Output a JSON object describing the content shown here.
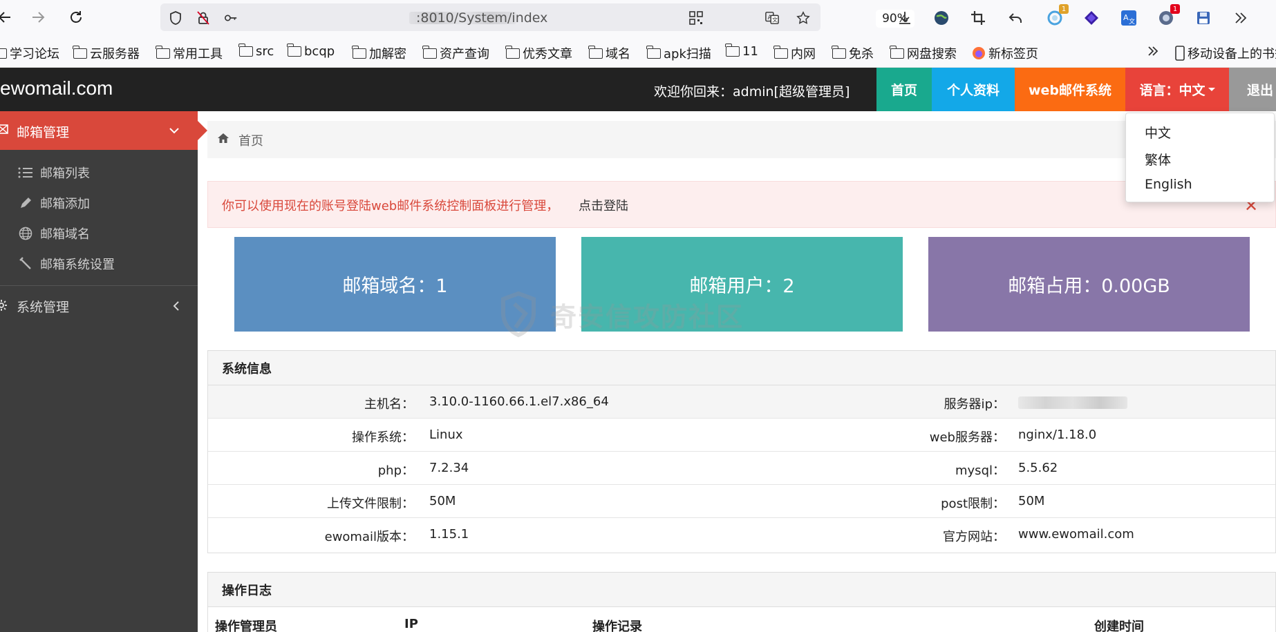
{
  "browser": {
    "url": ":8010/System/index",
    "zoom": "90%",
    "badge_yellow": "1",
    "badge_red": "1"
  },
  "bookmarks": [
    {
      "label": "学习论坛"
    },
    {
      "label": "云服务器"
    },
    {
      "label": "常用工具"
    },
    {
      "label": "src"
    },
    {
      "label": "bcqp"
    },
    {
      "label": "加解密"
    },
    {
      "label": "资产查询"
    },
    {
      "label": "优秀文章"
    },
    {
      "label": "域名"
    },
    {
      "label": "apk扫描"
    },
    {
      "label": "11"
    },
    {
      "label": "内网"
    },
    {
      "label": "免杀"
    },
    {
      "label": "网盘搜索"
    },
    {
      "label": "新标签页"
    }
  ],
  "bookmarks_mobile": "移动设备上的书签",
  "header": {
    "logo": "ewomail.com",
    "welcome": "欢迎你回来：admin[超级管理员]",
    "nav": {
      "home": "首页",
      "profile": "个人资料",
      "webmail": "web邮件系统",
      "language": "语言：中文",
      "logout": "退出"
    }
  },
  "sidebar": {
    "active": "邮箱管理",
    "items": [
      {
        "label": "邮箱列表"
      },
      {
        "label": "邮箱添加"
      },
      {
        "label": "邮箱域名"
      },
      {
        "label": "邮箱系统设置"
      }
    ],
    "system": "系统管理"
  },
  "breadcrumb": "首页",
  "alert": {
    "text": "你可以使用现在的账号登陆web邮件系统控制面板进行管理，",
    "link": "点击登陆"
  },
  "stats": {
    "domains": "邮箱域名：1",
    "users": "邮箱用户：2",
    "usage": "邮箱占用：0.00GB"
  },
  "watermark": "奇安信攻防社区",
  "system_info": {
    "title": "系统信息",
    "rows": [
      {
        "k1": "主机名：",
        "v1": "3.10.0-1160.66.1.el7.x86_64",
        "k2": "服务器ip：",
        "v2": ""
      },
      {
        "k1": "操作系统：",
        "v1": "Linux",
        "k2": "web服务器：",
        "v2": "nginx/1.18.0"
      },
      {
        "k1": "php：",
        "v1": "7.2.34",
        "k2": "mysql：",
        "v2": "5.5.62"
      },
      {
        "k1": "上传文件限制：",
        "v1": "50M",
        "k2": "post限制：",
        "v2": "50M"
      },
      {
        "k1": "ewomail版本：",
        "v1": "1.15.1",
        "k2": "官方网站：",
        "v2": "www.ewomail.com"
      }
    ]
  },
  "operation_log": {
    "title": "操作日志",
    "columns": [
      "操作管理员",
      "IP",
      "操作记录",
      "创建时间"
    ]
  },
  "language_menu": [
    "中文",
    "繁体",
    "English"
  ],
  "colors": {
    "header_bg": "#222222",
    "nav_home": "#19a98e",
    "nav_profile": "#13a8e8",
    "nav_webmail": "#fb6b12",
    "nav_language": "#e8433a",
    "nav_logout": "#999999",
    "sidebar_bg": "#3d3d3d",
    "sidebar_active": "#d9483b",
    "stat_blue": "#5b8fc1",
    "stat_teal": "#47b6ad",
    "stat_purple": "#8876a8"
  }
}
